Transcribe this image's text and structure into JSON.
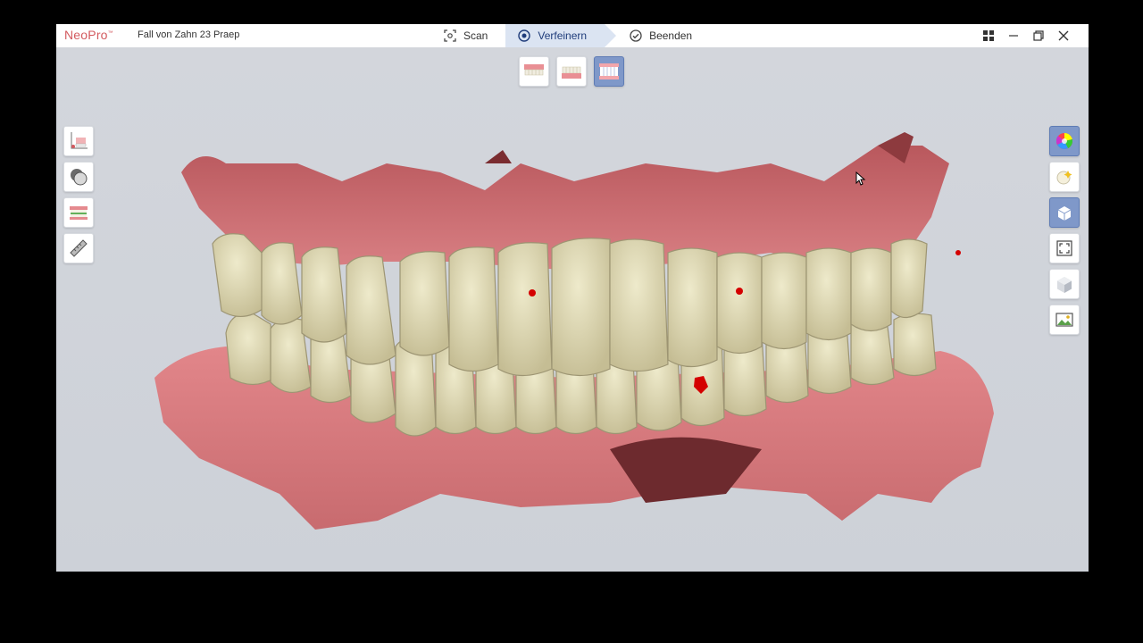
{
  "app": {
    "brand": "NeoPro",
    "brand_mark": "™",
    "case_title": "Fall von Zahn 23 Praep"
  },
  "workflow": {
    "steps": [
      {
        "label": "Scan",
        "icon": "scan-icon",
        "active": false
      },
      {
        "label": "Verfeinern",
        "icon": "refine-icon",
        "active": true
      },
      {
        "label": "Beenden",
        "icon": "check-circle-icon",
        "active": false
      }
    ]
  },
  "window_controls": [
    "apps-grid-icon",
    "minimize-icon",
    "restore-icon",
    "close-icon"
  ],
  "jaw_views": [
    {
      "name": "upper-jaw-view",
      "active": false
    },
    {
      "name": "lower-jaw-view",
      "active": false
    },
    {
      "name": "both-jaws-view",
      "active": true
    }
  ],
  "left_tools": [
    "trim-tool-icon",
    "material-tool-icon",
    "occlusion-tool-icon",
    "measure-ruler-icon"
  ],
  "right_tools": [
    {
      "name": "color-wheel-icon",
      "active": true
    },
    {
      "name": "texture-icon",
      "active": false
    },
    {
      "name": "view-cube-icon",
      "active": true
    },
    {
      "name": "fit-to-screen-icon",
      "active": false
    },
    {
      "name": "cube-icon",
      "active": false
    },
    {
      "name": "screenshot-image-icon",
      "active": false
    }
  ],
  "colors": {
    "brand": "#d35a5f",
    "active_tab": "#dbe4f2",
    "active_tool": "#7f98c9",
    "gum": "#c8686b",
    "tooth": "#e2dcb6",
    "contact_point": "#d40000"
  }
}
